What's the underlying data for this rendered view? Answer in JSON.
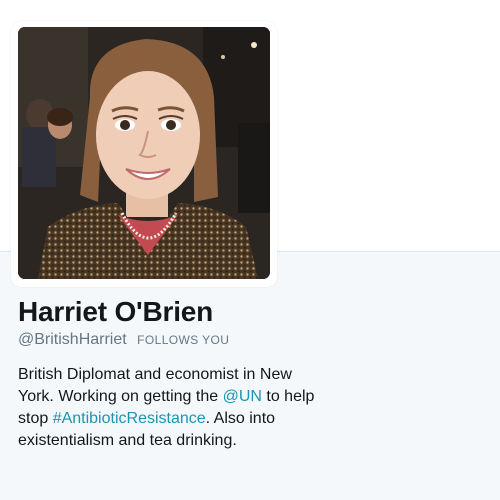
{
  "profile": {
    "avatar_alt": "Harriet O'Brien",
    "name": "Harriet O'Brien",
    "handle": "@BritishHarriet",
    "follows_badge": "FOLLOWS YOU",
    "bio": {
      "line1": "British Diplomat and economist in New",
      "line2_before": "York. Working on getting the ",
      "line2_mention": "@UN",
      "line2_after": " to help",
      "line3_before": "stop ",
      "line3_hashtag": "#AntibioticResistance",
      "line3_after": ". Also into",
      "line4": "existentialism and tea drinking."
    }
  },
  "colors": {
    "link": "#1b95b0",
    "name_text": "#14171a",
    "secondary_text": "#657786",
    "profile_background": "#f5f8fa"
  }
}
